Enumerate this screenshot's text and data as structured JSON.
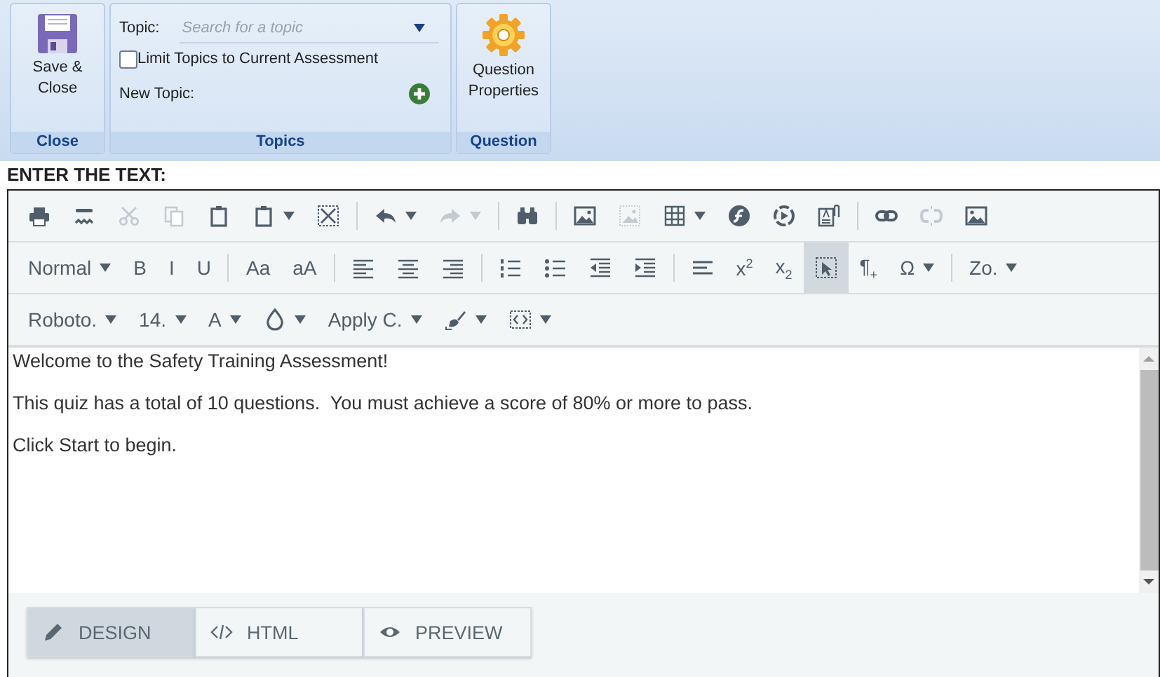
{
  "ribbon": {
    "save_button": "Save & Close",
    "close_group": "Close",
    "topic_label": "Topic:",
    "topic_search": {
      "placeholder": "Search for a topic"
    },
    "limit_checkbox": {
      "label": "Limit Topics to Current Assessment",
      "checked": false
    },
    "new_topic_label": "New Topic:",
    "topics_group": "Topics",
    "properties_button": "Question Properties",
    "question_group": "Question"
  },
  "heading": "ENTER THE TEXT:",
  "toolbar": {
    "rows": [
      [
        [
          {
            "kind": "icon",
            "dropdown": false,
            "disabled": false,
            "selected": false
          },
          {
            "kind": "icon",
            "dropdown": false,
            "disabled": false,
            "selected": false
          },
          {
            "kind": "icon",
            "dropdown": false,
            "disabled": true,
            "selected": false
          },
          {
            "kind": "icon",
            "dropdown": false,
            "disabled": true,
            "selected": false
          },
          {
            "kind": "icon",
            "dropdown": false,
            "disabled": false,
            "selected": false
          },
          {
            "kind": "icon",
            "dropdown": true,
            "disabled": false,
            "selected": false
          },
          {
            "kind": "icon",
            "dropdown": false,
            "disabled": false,
            "selected": false
          }
        ],
        [
          {
            "kind": "icon",
            "dropdown": true,
            "disabled": false,
            "selected": false
          },
          {
            "kind": "icon",
            "dropdown": true,
            "disabled": true,
            "selected": false
          }
        ],
        [
          {
            "kind": "icon",
            "dropdown": false,
            "disabled": false,
            "selected": false
          }
        ],
        [
          {
            "kind": "icon",
            "dropdown": false,
            "disabled": false,
            "selected": false
          },
          {
            "kind": "icon",
            "dropdown": false,
            "disabled": true,
            "selected": false
          },
          {
            "kind": "icon",
            "dropdown": true,
            "disabled": false,
            "selected": false
          },
          {
            "kind": "icon",
            "dropdown": false,
            "disabled": false,
            "selected": false
          },
          {
            "kind": "icon",
            "dropdown": false,
            "disabled": false,
            "selected": false
          },
          {
            "kind": "icon",
            "dropdown": false,
            "disabled": false,
            "selected": false
          }
        ],
        [
          {
            "kind": "icon",
            "dropdown": false,
            "disabled": false,
            "selected": false
          },
          {
            "kind": "icon",
            "dropdown": false,
            "disabled": true,
            "selected": false
          },
          {
            "kind": "icon",
            "dropdown": false,
            "disabled": false,
            "selected": false
          }
        ]
      ],
      [
        [
          {
            "kind": "text",
            "label": "Normal",
            "dropdown": true,
            "disabled": false,
            "selected": false
          },
          {
            "kind": "text",
            "label": "B",
            "dropdown": false,
            "disabled": false,
            "selected": false
          },
          {
            "kind": "text",
            "label": "I",
            "dropdown": false,
            "disabled": false,
            "selected": false
          },
          {
            "kind": "text",
            "label": "U",
            "dropdown": false,
            "disabled": false,
            "selected": false
          }
        ],
        [
          {
            "kind": "text",
            "label": "Aa",
            "dropdown": false,
            "disabled": false,
            "selected": false
          },
          {
            "kind": "text",
            "label": "aA",
            "dropdown": false,
            "disabled": false,
            "selected": false
          }
        ],
        [
          {
            "kind": "icon",
            "dropdown": false,
            "disabled": false,
            "selected": false
          },
          {
            "kind": "icon",
            "dropdown": false,
            "disabled": false,
            "selected": false
          },
          {
            "kind": "icon",
            "dropdown": false,
            "disabled": false,
            "selected": false
          }
        ],
        [
          {
            "kind": "icon",
            "dropdown": false,
            "disabled": false,
            "selected": false
          },
          {
            "kind": "icon",
            "dropdown": false,
            "disabled": false,
            "selected": false
          },
          {
            "kind": "icon",
            "dropdown": false,
            "disabled": false,
            "selected": false
          },
          {
            "kind": "icon",
            "dropdown": false,
            "disabled": false,
            "selected": false
          }
        ],
        [
          {
            "kind": "icon",
            "dropdown": false,
            "disabled": false,
            "selected": false
          },
          {
            "kind": "text",
            "label": "x$^{2}$",
            "dropdown": false,
            "disabled": false,
            "selected": false
          },
          {
            "kind": "text",
            "label": "x$_{2}$",
            "dropdown": false,
            "disabled": false,
            "selected": false
          },
          {
            "kind": "icon",
            "dropdown": false,
            "disabled": false,
            "selected": true
          },
          {
            "kind": "text",
            "label": "¶$_{+}$",
            "dropdown": false,
            "disabled": false,
            "selected": false
          },
          {
            "kind": "text",
            "label": "Ω",
            "dropdown": true,
            "disabled": false,
            "selected": false
          }
        ],
        [
          {
            "kind": "text",
            "label": "Zo.",
            "dropdown": true,
            "disabled": false,
            "selected": false
          }
        ]
      ],
      [
        [
          {
            "kind": "text",
            "label": "Roboto.",
            "dropdown": true,
            "disabled": false,
            "selected": false
          },
          {
            "kind": "text",
            "label": "14.",
            "dropdown": true,
            "disabled": false,
            "selected": false
          },
          {
            "kind": "text",
            "label": "A",
            "dropdown": true,
            "disabled": false,
            "selected": false
          },
          {
            "kind": "icon",
            "dropdown": true,
            "disabled": false,
            "selected": false
          },
          {
            "kind": "text",
            "label": "Apply C.",
            "dropdown": true,
            "disabled": false,
            "selected": false
          },
          {
            "kind": "icon",
            "dropdown": true,
            "disabled": false,
            "selected": false
          },
          {
            "kind": "icon",
            "dropdown": true,
            "disabled": false,
            "selected": false
          }
        ]
      ]
    ]
  },
  "content": [
    "Welcome to the Safety Training Assessment!",
    "This quiz has a total of 10 questions.  You must achieve a score of 80% or more to pass.",
    "Click Start to begin."
  ],
  "mode_tabs": [
    {
      "label": "DESIGN",
      "selected": true
    },
    {
      "label": "HTML",
      "selected": false
    },
    {
      "label": "PREVIEW",
      "selected": false
    }
  ]
}
